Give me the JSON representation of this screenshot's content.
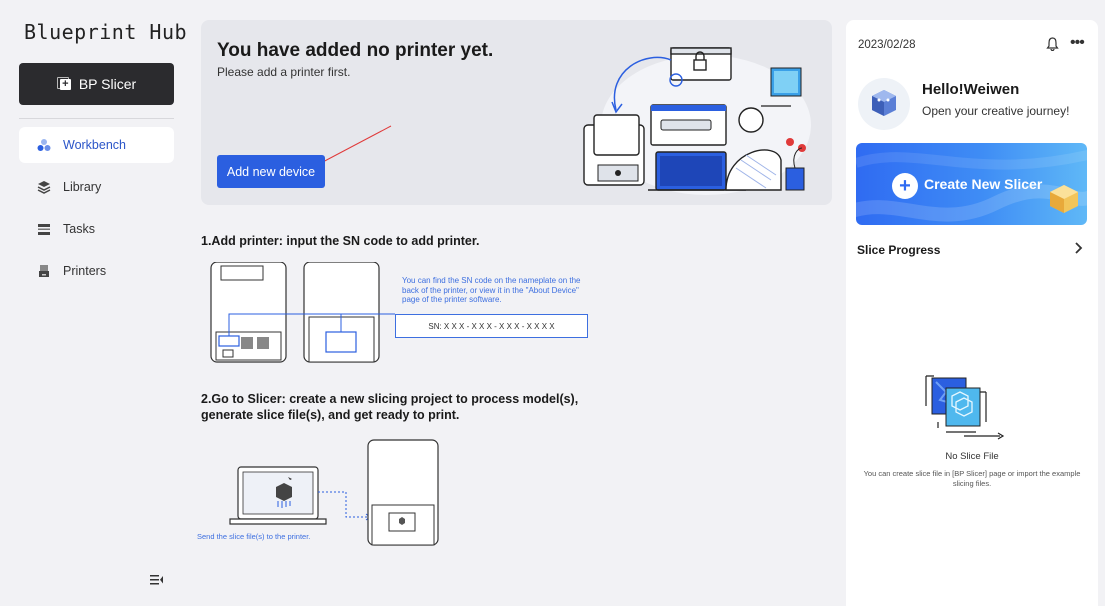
{
  "app": {
    "logo": "Blueprint Hub"
  },
  "sidebar": {
    "slicer_button": "BP Slicer",
    "items": [
      {
        "label": "Workbench",
        "icon": "workbench-icon",
        "active": true
      },
      {
        "label": "Library",
        "icon": "library-icon"
      },
      {
        "label": "Tasks",
        "icon": "tasks-icon"
      },
      {
        "label": "Printers",
        "icon": "printer-icon"
      }
    ]
  },
  "banner": {
    "title": "You have added no printer yet.",
    "subtitle": "Please add a printer first.",
    "button": "Add new device"
  },
  "steps": {
    "step1_title": "1.Add printer: input the SN code to add printer.",
    "sn_note": "You can find the SN code on the nameplate on the back of the printer, or view it in the \"About Device\" page of the printer software.",
    "sn_example": "SN: X X X - X X X - X X X - X X X X",
    "step2_title": "2.Go to Slicer: create a new slicing project to process model(s), generate slice file(s), and get ready to print.",
    "send_note": "Send the slice file(s) to the printer."
  },
  "right_panel": {
    "date": "2023/02/28",
    "greeting": "Hello!Weiwen",
    "tagline": "Open your creative journey!",
    "create_button": "Create New Slicer",
    "slice_progress": "Slice Progress",
    "empty_title": "No Slice File",
    "empty_desc": "You can create slice file in [BP Slicer] page or import the example slicing files."
  },
  "colors": {
    "accent": "#2b5fe0",
    "dark_button": "#2b2b2e",
    "link_blue": "#3d6fe0"
  }
}
